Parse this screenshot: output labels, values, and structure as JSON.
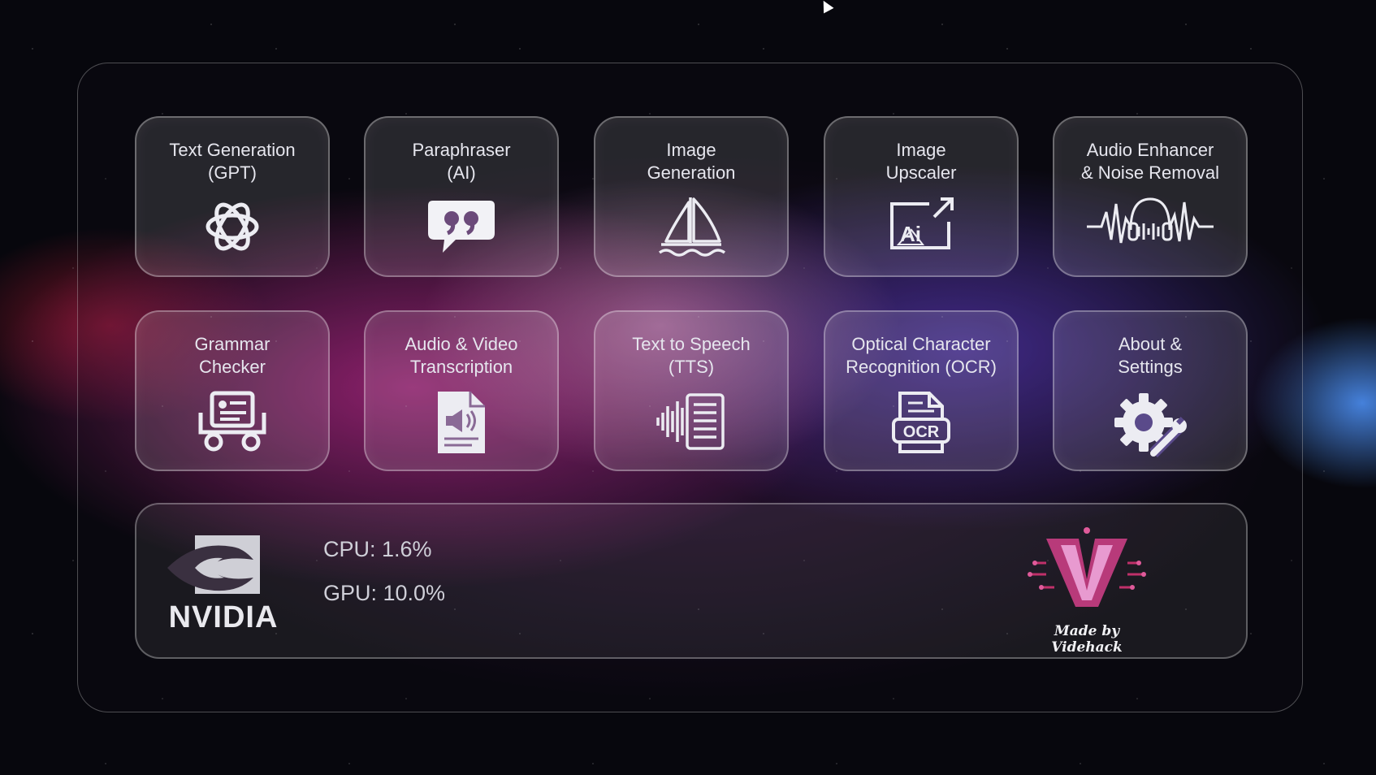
{
  "tiles": [
    {
      "label": "Text Generation\n(GPT)",
      "icon": "openai-icon"
    },
    {
      "label": "Paraphraser\n(AI)",
      "icon": "quote-bubble-icon"
    },
    {
      "label": "Image\nGeneration",
      "icon": "sailboat-icon"
    },
    {
      "label": "Image\nUpscaler",
      "icon": "ai-image-upscale-icon"
    },
    {
      "label": "Audio Enhancer\n& Noise Removal",
      "icon": "headphone-waveform-icon"
    },
    {
      "label": "Grammar\nChecker",
      "icon": "grammar-check-icon"
    },
    {
      "label": "Audio & Video\nTranscription",
      "icon": "audio-document-icon"
    },
    {
      "label": "Text to Speech\n(TTS)",
      "icon": "speech-waveform-document-icon"
    },
    {
      "label": "Optical Character\nRecognition (OCR)",
      "icon": "ocr-document-icon"
    },
    {
      "label": "About &\nSettings",
      "icon": "gear-wrench-icon"
    }
  ],
  "status": {
    "gpu_vendor": "NVIDIA",
    "cpu": "CPU: 1.6%",
    "gpu": "GPU: 10.0%",
    "credit": "Made by Videhack"
  }
}
